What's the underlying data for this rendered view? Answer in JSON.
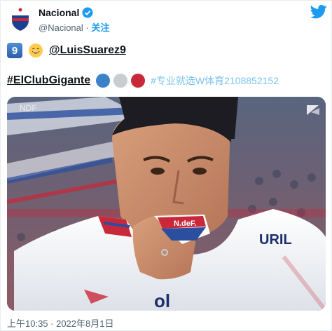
{
  "tweet": {
    "author_name": "Nacional",
    "author_handle": "@Nacional",
    "separator": "·",
    "follow_label": "关注",
    "keycap": "9",
    "mention": "@LuisSuarez9",
    "hashtag": "#ElClubGigante",
    "watermark": "#专业就选W体育2108852152",
    "timestamp": "上午10:35 · 2022年8月1日",
    "flag_dot_colors": [
      "#3b82c8",
      "#c9ccd1",
      "#c8283a"
    ]
  },
  "media": {
    "broadcast_logo": "NDF",
    "shirt_sponsor": "URIL",
    "crest_text": "N.deF."
  },
  "colors": {
    "accent": "#1d9bf0",
    "verified": "#1d9bf0",
    "text": "#0f1419",
    "muted": "#536471"
  },
  "icons": [
    "club-crest-avatar",
    "verified-badge-icon",
    "twitter-bird-icon",
    "keycap-9",
    "grinning-face-emoji"
  ]
}
